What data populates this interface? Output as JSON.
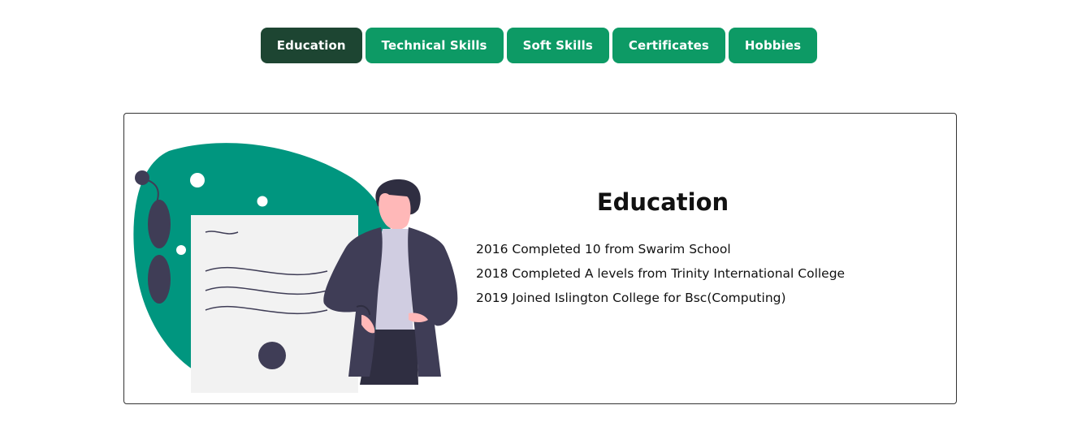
{
  "tabs": [
    {
      "label": "Education",
      "active": true
    },
    {
      "label": "Technical Skills",
      "active": false
    },
    {
      "label": "Soft Skills",
      "active": false
    },
    {
      "label": "Certificates",
      "active": false
    },
    {
      "label": "Hobbies",
      "active": false
    }
  ],
  "panel": {
    "title": "Education",
    "items": [
      "2016 Completed 10 from Swarim School",
      "2018 Completed A levels from Trinity International College",
      "2019 Joined Islington College for Bsc(Computing)"
    ]
  },
  "colors": {
    "tab_bg": "#0d9a65",
    "tab_active_bg": "#1d4532",
    "blob": "#00967f",
    "figure_dark": "#3f3d56"
  },
  "illustration": {
    "icon": "person-with-document-illustration"
  }
}
